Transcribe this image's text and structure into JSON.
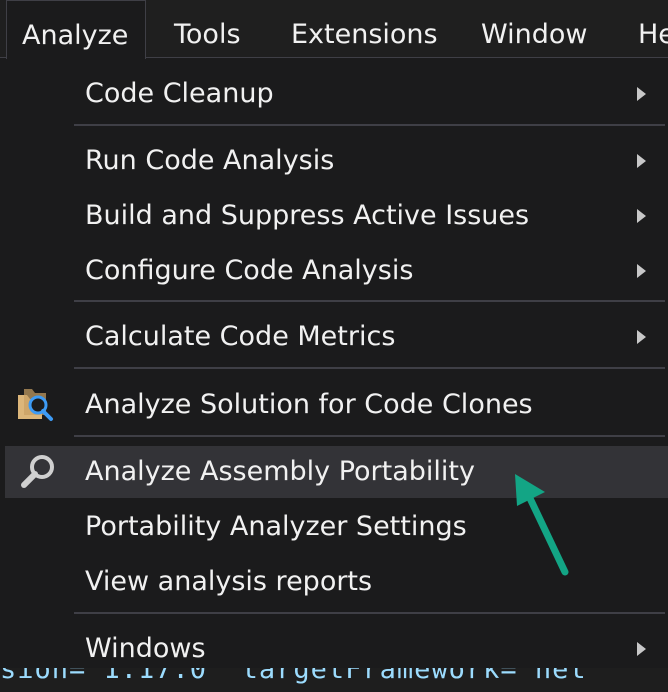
{
  "menubar": {
    "items": [
      "Analyze",
      "Tools",
      "Extensions",
      "Window",
      "He"
    ]
  },
  "menu": {
    "items": [
      {
        "label": "Code Cleanup",
        "submenu": true
      },
      {
        "label": "Run Code Analysis",
        "submenu": true
      },
      {
        "label": "Build and Suppress Active Issues",
        "submenu": true
      },
      {
        "label": "Configure Code Analysis",
        "submenu": true
      },
      {
        "label": "Calculate Code Metrics",
        "submenu": true
      },
      {
        "label": "Analyze Solution for Code Clones",
        "icon": "code-clones-icon"
      },
      {
        "label": "Analyze Assembly Portability",
        "icon": "magnifier-icon",
        "highlighted": true
      },
      {
        "label": "Portability Analyzer Settings"
      },
      {
        "label": "View analysis reports"
      },
      {
        "label": "Windows",
        "submenu": true
      }
    ]
  },
  "code_strip": {
    "text": "sion= 1.17.0  targetFramework= net"
  },
  "colors": {
    "annotation_arrow": "#13a585",
    "menu_bg": "#1b1b1c",
    "highlight_bg": "#333337",
    "separator": "#3f3f46"
  }
}
